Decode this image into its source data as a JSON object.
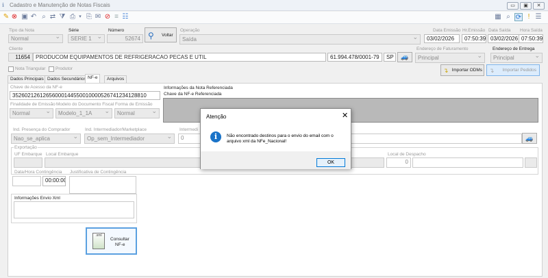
{
  "window": {
    "title": "Cadastro e Manutenção de Notas Fiscais",
    "minimize": "▭",
    "maximize": "▣",
    "close": "✕"
  },
  "header": {
    "tipo_nota": {
      "label": "Tipo da Nota",
      "value": "Normal"
    },
    "serie": {
      "label": "Série",
      "value": "SERIE 1"
    },
    "numero": {
      "label": "Número",
      "value": "52674"
    },
    "voltar_label": "Voltar",
    "operacao": {
      "label": "Operação",
      "value": "Saída"
    },
    "data_emissao": {
      "label": "Data Emissão",
      "value": "03/02/2026"
    },
    "hr_emissao": {
      "label": "Hr.Emissão",
      "value": "07:50:39"
    },
    "data_saida": {
      "label": "Data Saída",
      "value": "03/02/2026"
    },
    "hora_saida": {
      "label": "Hora Saída",
      "value": "07:50:39"
    }
  },
  "cliente": {
    "label": "Cliente",
    "code": "11654",
    "name": "PRODUCOM EQUIPAMENTOS DE REFRIGERACAO PECAS E UTIL",
    "cnpj": "61.994.478/0001-79",
    "uf": "SP"
  },
  "enderecos": {
    "faturamento_label": "Endereço de Faturamento",
    "faturamento_value": "Principal",
    "entrega_label": "Endereço de Entrega",
    "entrega_value": "Principal"
  },
  "flags": {
    "nota_triangular": "Nota Triangular",
    "produtor": "Produtor"
  },
  "actions": {
    "importar_odms": "Importar ODMs",
    "importar_pedidos": "Importar Pedidos"
  },
  "tabs": [
    "Dados Principais",
    "Dados Secundários",
    "NF-e",
    "Arquivos"
  ],
  "nfe": {
    "chave_label": "Chave de Acesso da NF-e",
    "chave_value": "35260212612656000144550010000526741234128810",
    "finalidade_label": "Finalidade de Emissão",
    "finalidade_value": "Normal",
    "modelo_label": "Modelo do Documento Fiscal",
    "modelo_value": "Modelo_1_1A",
    "forma_label": "Forma de Emissão",
    "forma_value": "Normal",
    "info_ref_label": "Informações da Nota Referenciada",
    "chave_ref_label": "Chave da NF-e Referenciada",
    "presenca_label": "Ind. Presença do Comprador",
    "presenca_value": "Nao_se_aplica",
    "intermed_label": "Ind. Intermediador/Marketplace",
    "intermed_value": "Op_sem_Intermediador",
    "intermediario_label": "Intermedi",
    "exportacao_label": "Exportação",
    "uf_embarque_label": "UF Embarque",
    "local_embarque_label": "Local Embarque",
    "local_despacho_label": "Local de Despacho",
    "local_despacho_value": "0",
    "data_hora_cont_label": "Data/Hora Contingência",
    "hora_cont_value": "00:00:00",
    "justificativa_label": "Justificativa de Contingência",
    "info_envio_label": "Informações Envio Xml",
    "consultar_line1": "Consultar",
    "consultar_line2": "NF-e"
  },
  "dialog": {
    "title": "Atenção",
    "message_line1": "Não encontrado destinos para o envio do email com o",
    "message_line2": "arquivo xml da NFe_Nacional!",
    "ok": "OK"
  }
}
